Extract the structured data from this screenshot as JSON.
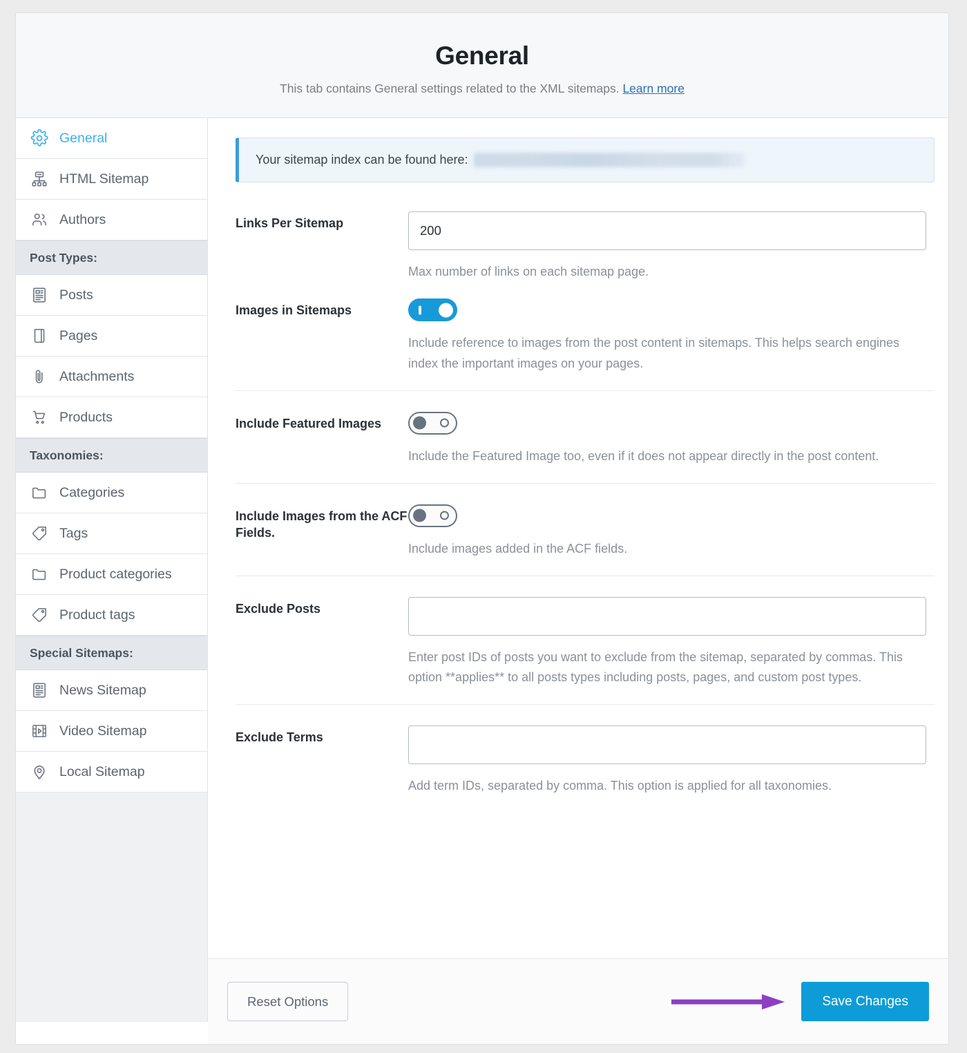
{
  "header": {
    "title": "General",
    "subtitle_text": "This tab contains General settings related to the XML sitemaps.",
    "learn_more_label": "Learn more"
  },
  "sidebar": {
    "items": [
      {
        "label": "General",
        "icon": "gear-icon",
        "active": true
      },
      {
        "label": "HTML Sitemap",
        "icon": "sitemap-icon",
        "active": false
      },
      {
        "label": "Authors",
        "icon": "users-icon",
        "active": false
      }
    ],
    "sections": [
      {
        "heading": "Post Types:",
        "items": [
          {
            "label": "Posts",
            "icon": "article-icon"
          },
          {
            "label": "Pages",
            "icon": "page-icon"
          },
          {
            "label": "Attachments",
            "icon": "paperclip-icon"
          },
          {
            "label": "Products",
            "icon": "cart-icon"
          }
        ]
      },
      {
        "heading": "Taxonomies:",
        "items": [
          {
            "label": "Categories",
            "icon": "folder-icon"
          },
          {
            "label": "Tags",
            "icon": "tag-icon"
          },
          {
            "label": "Product categories",
            "icon": "folder-icon"
          },
          {
            "label": "Product tags",
            "icon": "tag-icon"
          }
        ]
      },
      {
        "heading": "Special Sitemaps:",
        "items": [
          {
            "label": "News Sitemap",
            "icon": "newspaper-icon"
          },
          {
            "label": "Video Sitemap",
            "icon": "film-icon"
          },
          {
            "label": "Local Sitemap",
            "icon": "map-pin-icon"
          }
        ]
      }
    ]
  },
  "notice": {
    "text": "Your sitemap index can be found here:",
    "url_redacted": true
  },
  "fields": {
    "links_per_sitemap": {
      "label": "Links Per Sitemap",
      "value": "200",
      "help": "Max number of links on each sitemap page."
    },
    "images_in_sitemaps": {
      "label": "Images in Sitemaps",
      "state": "on",
      "help": "Include reference to images from the post content in sitemaps. This helps search engines index the important images on your pages."
    },
    "include_featured_images": {
      "label": "Include Featured Images",
      "state": "off",
      "help": "Include the Featured Image too, even if it does not appear directly in the post content."
    },
    "include_acf_images": {
      "label": "Include Images from the ACF Fields.",
      "state": "off",
      "help": "Include images added in the ACF fields."
    },
    "exclude_posts": {
      "label": "Exclude Posts",
      "value": "",
      "help": "Enter post IDs of posts you want to exclude from the sitemap, separated by commas. This option **applies** to all posts types including posts, pages, and custom post types."
    },
    "exclude_terms": {
      "label": "Exclude Terms",
      "value": "",
      "help": "Add term IDs, separated by comma. This option is applied for all taxonomies."
    }
  },
  "footer": {
    "reset_label": "Reset Options",
    "save_label": "Save Changes",
    "annotation_arrow": "purple-arrow"
  },
  "colors": {
    "accent_blue": "#0d9cd7",
    "toggle_on": "#179ad9",
    "toggle_off": "#69737f",
    "active_nav": "#3eb0ef",
    "notice_border": "#3c9ddb",
    "annotation_purple": "#8b3fc4",
    "page_bg": "#ececec"
  }
}
